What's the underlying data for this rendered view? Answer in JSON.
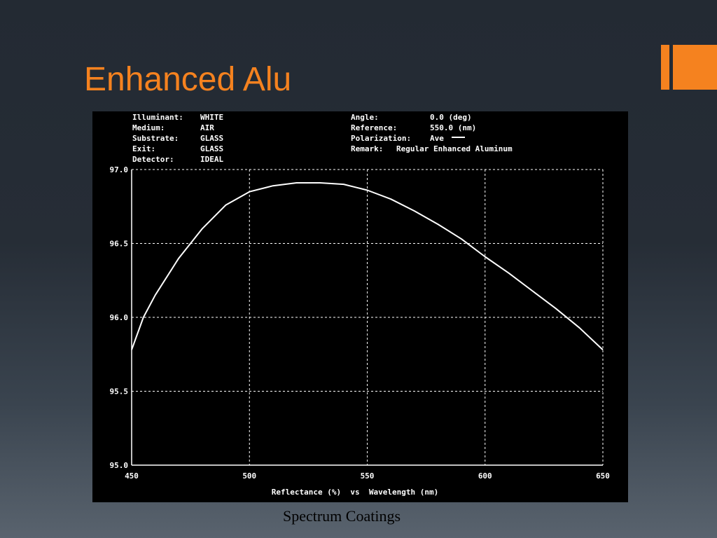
{
  "slide": {
    "title": "Enhanced Alu",
    "caption": "Spectrum Coatings",
    "accent_color": "#f5821f"
  },
  "header": {
    "left": [
      {
        "label": "Illuminant:",
        "value": "WHITE"
      },
      {
        "label": "Medium:",
        "value": "AIR"
      },
      {
        "label": "Substrate:",
        "value": "GLASS"
      },
      {
        "label": "Exit:",
        "value": "GLASS"
      },
      {
        "label": "Detector:",
        "value": "IDEAL"
      }
    ],
    "right": [
      {
        "label": "Angle:",
        "value": "0.0 (deg)"
      },
      {
        "label": "Reference:",
        "value": "550.0 (nm)"
      },
      {
        "label": "Polarization:",
        "value": "Ave"
      },
      {
        "label": "Remark:",
        "value": "Regular Enhanced Aluminum"
      }
    ]
  },
  "chart_data": {
    "type": "line",
    "xlabel": "Reflectance (%)  vs  Wavelength (nm)",
    "ylabel": "",
    "xlim": [
      450,
      650
    ],
    "ylim": [
      95.0,
      97.0
    ],
    "x_ticks": [
      "450",
      "500",
      "550",
      "600",
      "650"
    ],
    "y_ticks": [
      "97.0",
      "96.5",
      "96.0",
      "95.5",
      "95.0"
    ],
    "grid": true,
    "series": [
      {
        "x": [
          450,
          455,
          460,
          470,
          480,
          490,
          500,
          510,
          520,
          530,
          540,
          550,
          560,
          570,
          580,
          590,
          600,
          610,
          620,
          630,
          640,
          650
        ],
        "y": [
          95.78,
          96.0,
          96.15,
          96.4,
          96.6,
          96.76,
          96.85,
          96.89,
          96.91,
          96.91,
          96.9,
          96.86,
          96.8,
          96.72,
          96.63,
          96.53,
          96.41,
          96.3,
          96.18,
          96.06,
          95.93,
          95.78
        ]
      }
    ]
  }
}
